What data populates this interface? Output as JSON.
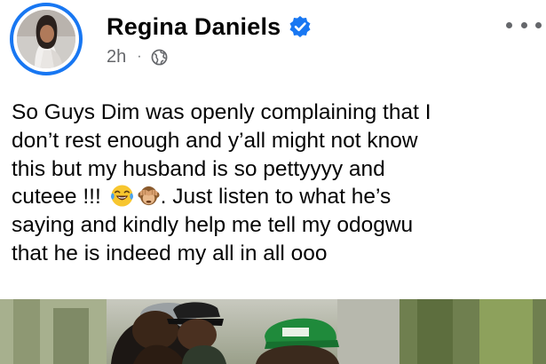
{
  "post": {
    "author_name": "Regina Daniels",
    "timestamp": "2h",
    "separator": "·",
    "audience_icon": "globe-icon",
    "verified_icon": "verified-badge-icon",
    "more_icon": "more-options-icon",
    "caption_lines": [
      "So Guys Dim was openly complaining that I",
      "don’t rest enough and y’all might not know",
      "this but my husband is so pettyyyy and",
      "cuteee !!! ",
      "that he is indeed my all in all ooo"
    ],
    "caption_line4_tail": ". Just listen to what he’s",
    "caption_line5": "saying and kindly help me tell my odogwu",
    "emojis": [
      "laughing-crying-emoji",
      "see-no-evil-monkey-emoji"
    ]
  },
  "colors": {
    "accent": "#1877f2",
    "text_primary": "#050505",
    "text_secondary": "#65676b"
  }
}
